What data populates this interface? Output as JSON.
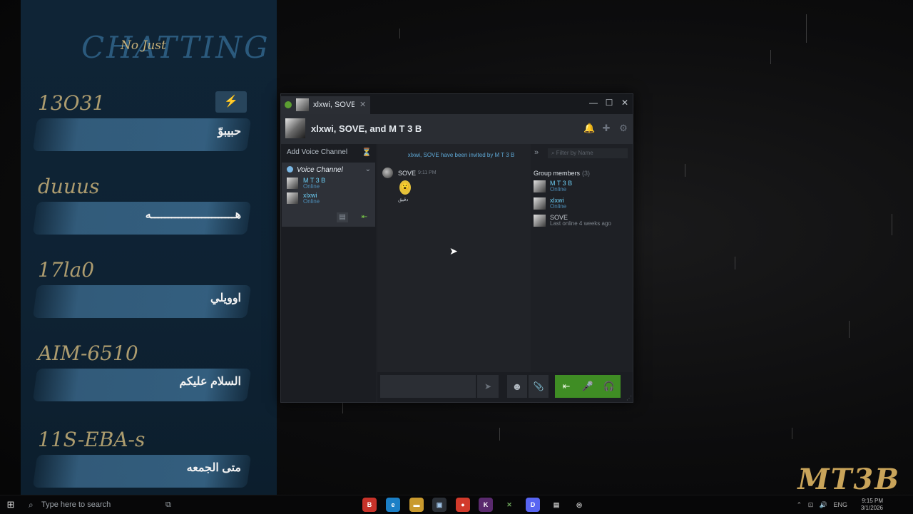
{
  "side_panel": {
    "heading": "CHATTING",
    "subheading": "No Just",
    "entries": [
      {
        "name": "13O31",
        "message": "حبيبوّ"
      },
      {
        "name": "duuus",
        "message": "هـــــــــــــــــــــــــه"
      },
      {
        "name": "17la0",
        "message": "اوويلي"
      },
      {
        "name": "AIM-6510",
        "message": "السلام عليكم"
      },
      {
        "name": "11S-EBA-s",
        "message": "متى الجمعه"
      }
    ]
  },
  "steam_chat": {
    "tab_label": "xlxwi, SOVE, a",
    "title": "xlxwi, SOVE, and M T 3 B",
    "add_voice_channel": "Add Voice Channel",
    "voice_channel": {
      "label": "Voice Channel",
      "users": [
        {
          "name": "M T 3 B",
          "status": "Online"
        },
        {
          "name": "xlxwi",
          "status": "Online"
        }
      ]
    },
    "system_message": "xlxwi, SOVE have been invited by M T 3 B",
    "message": {
      "author": "SOVE",
      "time": "9:11 PM",
      "sticker_caption": "دقيق"
    },
    "members": {
      "filter_placeholder": "Filter by Name",
      "group_title": "Group members",
      "count": "(3)",
      "list": [
        {
          "name": "M T 3 B",
          "status": "Online",
          "color": "#6dcff6",
          "status_color": "#4c8cb6"
        },
        {
          "name": "xlxwi",
          "status": "Online",
          "color": "#6dcff6",
          "status_color": "#4c8cb6"
        },
        {
          "name": "SOVE",
          "status": "Last online 4 weeks ago",
          "color": "#c8cdd3",
          "status_color": "#7e858d"
        }
      ]
    }
  },
  "taskbar": {
    "search_placeholder": "Type here to search",
    "language": "ENG",
    "time": "9:15 PM",
    "date": "3/1/2026",
    "apps": [
      "brave",
      "edge",
      "file-explorer",
      "steam",
      "chrome",
      "kick",
      "xbox",
      "discord",
      "notepad",
      "steam-client"
    ]
  },
  "wallpaper_logo": "MT3B"
}
